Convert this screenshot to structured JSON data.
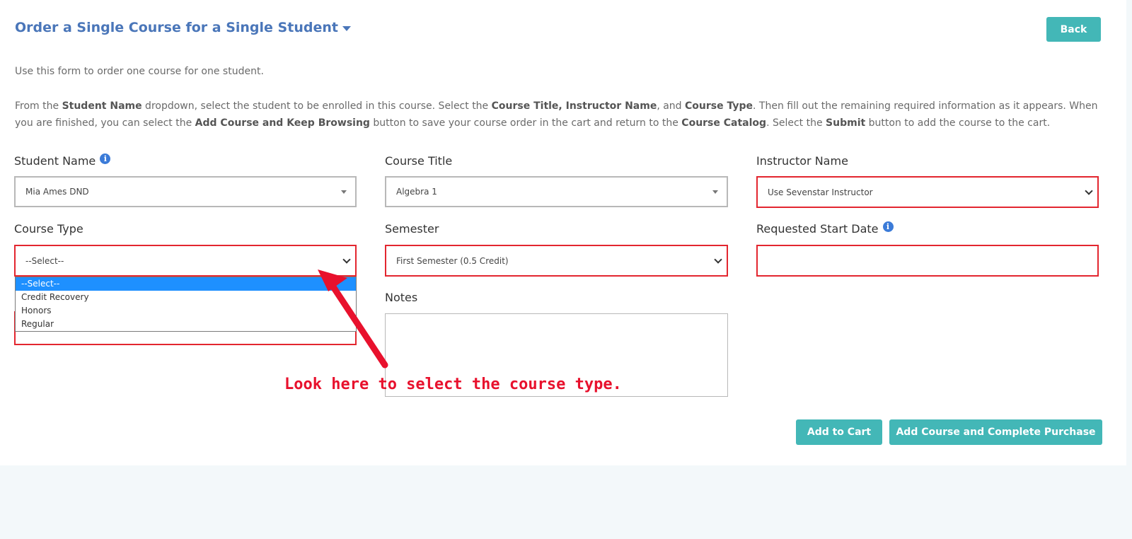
{
  "header": {
    "title": "Order a Single Course for a Single Student",
    "back_label": "Back"
  },
  "intro": "Use this form to order one course for one student.",
  "instructions": {
    "p1": "From the ",
    "b1": "Student Name",
    "p2": " dropdown, select the student to be enrolled in this course. Select the ",
    "b2": "Course Title, Instructor Name",
    "p3": ", and ",
    "b3": "Course Type",
    "p4": ". Then fill out the remaining required information as it appears. When you are finished, you can select the ",
    "b4": "Add Course and Keep Browsing",
    "p5": " button to save your course order in the cart and return to the ",
    "b5": "Course Catalog",
    "p6": ". Select the ",
    "b6": "Submit",
    "p7": " button to add the course to the cart."
  },
  "fields": {
    "student_name": {
      "label": "Student Name",
      "value": "Mia Ames DND"
    },
    "course_title": {
      "label": "Course Title",
      "value": "Algebra 1"
    },
    "instructor_name": {
      "label": "Instructor Name",
      "value": "Use Sevenstar Instructor"
    },
    "course_type": {
      "label": "Course Type",
      "value": "--Select--"
    },
    "semester": {
      "label": "Semester",
      "value": "First Semester (0.5 Credit)"
    },
    "requested_start_date": {
      "label": "Requested Start Date",
      "value": ""
    },
    "notes": {
      "label": "Notes",
      "value": ""
    }
  },
  "course_type_options": [
    "--Select--",
    "Credit Recovery",
    "Honors",
    "Regular"
  ],
  "buttons": {
    "add_to_cart": "Add to Cart",
    "add_and_purchase": "Add Course and Complete Purchase"
  },
  "annotation": "Look here to select the course type.",
  "colors": {
    "title": "#4a76b9",
    "button": "#43b7b7",
    "required_border": "#e3262f",
    "annotation": "#e8112d",
    "selected_option": "#1e90ff"
  }
}
